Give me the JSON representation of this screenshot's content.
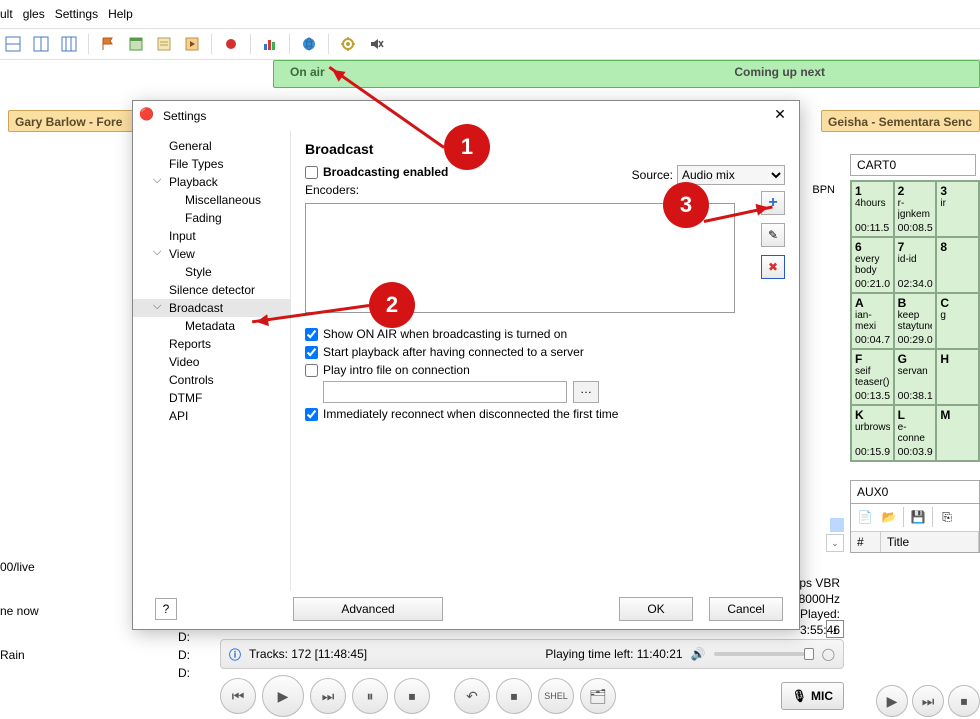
{
  "menu": {
    "items": [
      "ult",
      "gles",
      "Settings",
      "Help"
    ]
  },
  "onair": {
    "label": "On air",
    "coming": "Coming up next"
  },
  "now_playing": "Gary Barlow - Fore",
  "next_up": "Geisha - Sementara Senc",
  "bpm_label": "BPN",
  "enc_info": [
    "ps VBR",
    "8000Hz",
    "Played:",
    "3:55:46"
  ],
  "left_frags": [
    "00/live",
    "ne now",
    "Rain"
  ],
  "d_col": [
    "D:",
    "D:",
    "D:"
  ],
  "cart": {
    "title": "CART0",
    "cells": [
      [
        {
          "l": "1",
          "n": "4hours",
          "t": "00:11.5"
        },
        {
          "l": "2",
          "n": "r-jgnkem",
          "t": "00:08.5"
        },
        {
          "l": "3",
          "n": "ir",
          "t": ""
        }
      ],
      [
        {
          "l": "6",
          "n": "every body",
          "t": "00:21.0"
        },
        {
          "l": "7",
          "n": "id-id",
          "t": "02:34.0"
        },
        {
          "l": "8",
          "n": "",
          "t": ""
        }
      ],
      [
        {
          "l": "A",
          "n": "ian-mexi",
          "t": "00:04.7"
        },
        {
          "l": "B",
          "n": "keep staytune",
          "t": "00:29.0"
        },
        {
          "l": "C",
          "n": "g",
          "t": ""
        }
      ],
      [
        {
          "l": "F",
          "n": "seif teaser()",
          "t": "00:13.5"
        },
        {
          "l": "G",
          "n": "servan",
          "t": "00:38.1"
        },
        {
          "l": "H",
          "n": "",
          "t": ""
        }
      ],
      [
        {
          "l": "K",
          "n": "urbrows",
          "t": "00:15.9"
        },
        {
          "l": "L",
          "n": "e-conne",
          "t": "00:03.9"
        },
        {
          "l": "M",
          "n": "",
          "t": ""
        }
      ]
    ]
  },
  "aux": {
    "title": "AUX0",
    "cols": [
      "#",
      "Title"
    ]
  },
  "tracks_bar": {
    "tracks": "Tracks: 172 [11:48:45]",
    "time_left": "Playing time left: 11:40:21"
  },
  "mic_btn": "MIC",
  "dialog": {
    "title": "Settings",
    "tree": [
      "General",
      "File Types",
      "Playback",
      "Miscellaneous",
      "Fading",
      "Input",
      "View",
      "Style",
      "Silence detector",
      "Broadcast",
      "Metadata",
      "Reports",
      "Video",
      "Controls",
      "DTMF",
      "API"
    ],
    "panel": {
      "heading": "Broadcast",
      "enabled": "Broadcasting enabled",
      "encoders": "Encoders:",
      "source_lbl": "Source:",
      "source_val": "Audio mix",
      "opt_onair": "Show ON AIR when broadcasting is turned on",
      "opt_start": "Start playback after having connected to a server",
      "opt_intro": "Play intro file on connection",
      "opt_reconnect": "Immediately reconnect when disconnected the first time",
      "advanced": "Advanced",
      "ok": "OK",
      "cancel": "Cancel"
    }
  },
  "annotations": {
    "b1": "1",
    "b2": "2",
    "b3": "3"
  }
}
